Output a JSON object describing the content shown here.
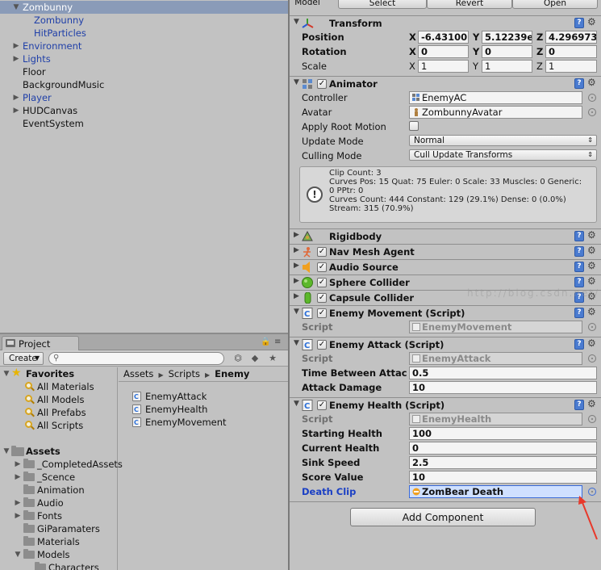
{
  "hierarchy": {
    "items": [
      {
        "label": "Zombunny",
        "expanded": true,
        "selected": true
      },
      {
        "label": "Zombunny"
      },
      {
        "label": "HitParticles"
      },
      {
        "label": "Environment"
      },
      {
        "label": "Lights"
      },
      {
        "label": "Floor"
      },
      {
        "label": "BackgroundMusic"
      },
      {
        "label": "Player"
      },
      {
        "label": "HUDCanvas"
      },
      {
        "label": "EventSystem"
      }
    ]
  },
  "project": {
    "tab_label": "Project",
    "create_label": "Create",
    "search": {
      "value": "",
      "placeholder": ""
    },
    "favorites": {
      "header": "Favorites",
      "items": [
        "All Materials",
        "All Models",
        "All Prefabs",
        "All Scripts"
      ]
    },
    "assets": {
      "header": "Assets",
      "items": [
        "_CompletedAssets",
        "_Scence",
        "Animation",
        "Audio",
        "Fonts",
        "GiParamaters",
        "Materials",
        "Models",
        "Characters"
      ]
    },
    "breadcrumb": [
      "Assets",
      "Scripts",
      "Enemy"
    ],
    "files": [
      "EnemyAttack",
      "EnemyHealth",
      "EnemyMovement"
    ]
  },
  "inspector": {
    "top_buttons": [
      "Model",
      "Select",
      "Revert",
      "Open"
    ],
    "transform": {
      "title": "Transform",
      "position": {
        "label": "Position",
        "x": "-6.43100",
        "y": "5.12239e",
        "z": "4.296973"
      },
      "rotation": {
        "label": "Rotation",
        "x": "0",
        "y": "0",
        "z": "0"
      },
      "scale": {
        "label": "Scale",
        "x": "1",
        "y": "1",
        "z": "1"
      },
      "axis_x": "X",
      "axis_y": "Y",
      "axis_z": "Z"
    },
    "animator": {
      "title": "Animator",
      "controller_label": "Controller",
      "controller_value": "EnemyAC",
      "avatar_label": "Avatar",
      "avatar_value": "ZombunnyAvatar",
      "apply_root_motion_label": "Apply Root Motion",
      "update_mode_label": "Update Mode",
      "update_mode_value": "Normal",
      "culling_mode_label": "Culling Mode",
      "culling_mode_value": "Cull Update Transforms",
      "info_lines": [
        "Clip Count: 3",
        "Curves Pos: 15 Quat: 75 Euler: 0 Scale: 33 Muscles: 0 Generic:",
        "0 PPtr: 0",
        "Curves Count: 444 Constant: 129 (29.1%) Dense: 0 (0.0%)",
        "Stream: 315 (70.9%)"
      ]
    },
    "rigidbody": {
      "title": "Rigidbody"
    },
    "nav_mesh_agent": {
      "title": "Nav Mesh Agent"
    },
    "audio_source": {
      "title": "Audio Source"
    },
    "sphere_collider": {
      "title": "Sphere Collider"
    },
    "capsule_collider": {
      "title": "Capsule Collider"
    },
    "enemy_movement": {
      "title": "Enemy Movement (Script)",
      "script_label": "Script",
      "script_value": "EnemyMovement"
    },
    "enemy_attack": {
      "title": "Enemy Attack (Script)",
      "script_label": "Script",
      "script_value": "EnemyAttack",
      "time_between_label": "Time Between Attac",
      "time_between_value": "0.5",
      "damage_label": "Attack Damage",
      "damage_value": "10"
    },
    "enemy_health": {
      "title": "Enemy Health (Script)",
      "script_label": "Script",
      "script_value": "EnemyHealth",
      "starting_label": "Starting Health",
      "starting_value": "100",
      "current_label": "Current Health",
      "current_value": "0",
      "sink_label": "Sink Speed",
      "sink_value": "2.5",
      "score_label": "Score Value",
      "score_value": "10",
      "death_clip_label": "Death Clip",
      "death_clip_value": "ZomBear Death"
    },
    "add_component_label": "Add Component"
  },
  "watermark": "http://blog.csdn.net/",
  "colors": {
    "selection": "#8a9bb8",
    "link_blue": "#1f3fa8",
    "annotation_arrow": "#e8392b"
  }
}
